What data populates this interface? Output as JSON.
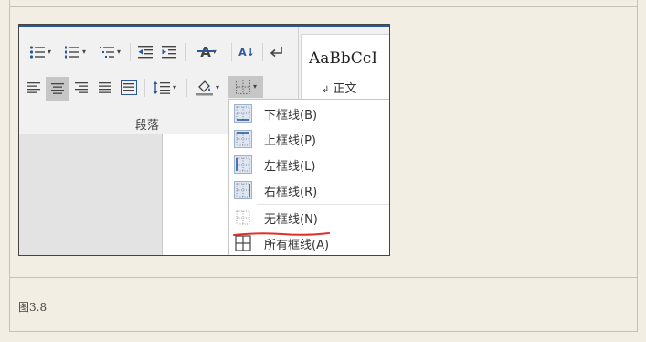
{
  "ribbon": {
    "group_label": "段落",
    "font_toolbar_glyph": "A",
    "sort_glyph": "A↓",
    "icons": [
      "bullets-icon",
      "numbering-icon",
      "multilevel-list-icon",
      "decrease-indent-icon",
      "increase-indent-icon",
      "asian-layout-icon",
      "sort-icon",
      "show-marks-icon",
      "align-left-icon",
      "align-center-icon",
      "align-right-icon",
      "justify-icon",
      "distributed-icon",
      "line-spacing-icon",
      "shading-icon",
      "borders-icon"
    ]
  },
  "styles": {
    "sample_text": "AaBbCcI",
    "paragraph_mark": "↲",
    "style_name": "正文"
  },
  "border_menu": {
    "items": [
      {
        "label": "下框线(B)",
        "icon": "bottom-border-icon"
      },
      {
        "label": "上框线(P)",
        "icon": "top-border-icon"
      },
      {
        "label": "左框线(L)",
        "icon": "left-border-icon"
      },
      {
        "label": "右框线(R)",
        "icon": "right-border-icon"
      },
      {
        "label": "无框线(N)",
        "icon": "no-border-icon"
      },
      {
        "label": "所有框线(A)",
        "icon": "all-borders-icon"
      }
    ]
  },
  "annotation_color": "#e0302a",
  "accent_color": "#2b579a",
  "caption": "图3.8"
}
